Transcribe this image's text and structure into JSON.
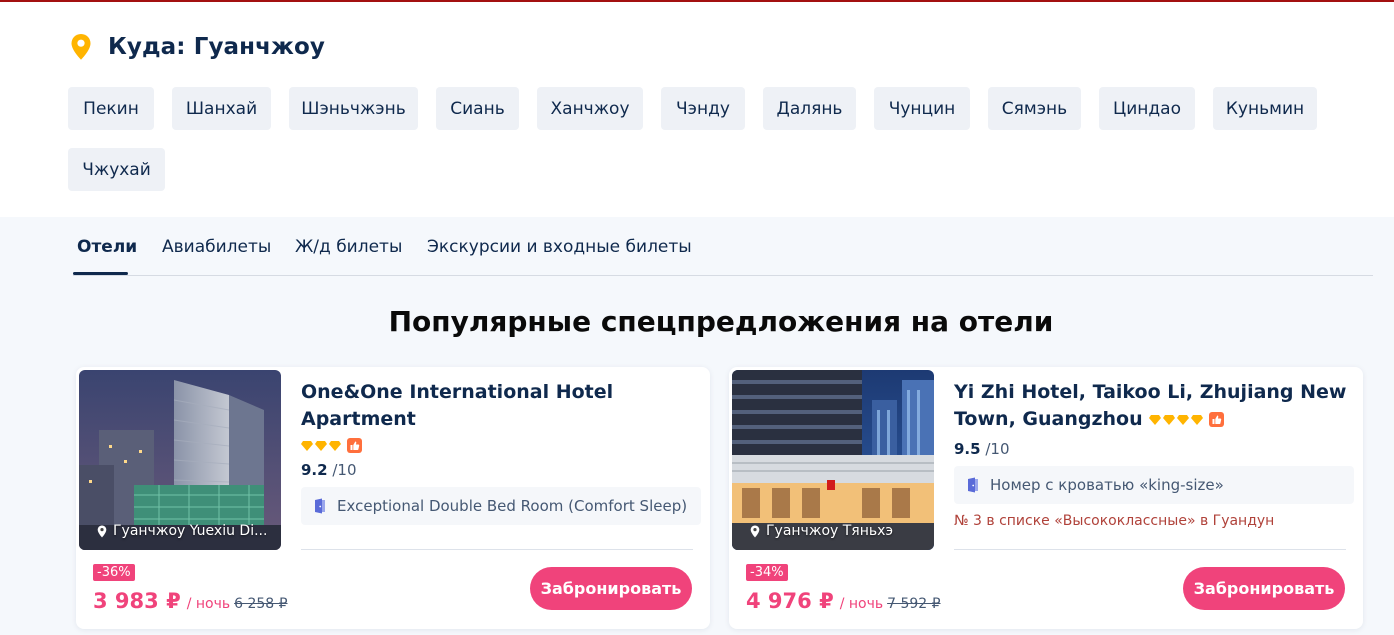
{
  "destination": {
    "label": "Куда: Гуанчжоу",
    "cities": [
      "Пекин",
      "Шанхай",
      "Шэньчжэнь",
      "Сиань",
      "Ханчжоу",
      "Чэнду",
      "Далянь",
      "Чунцин",
      "Сямэнь",
      "Циндао",
      "Куньмин",
      "Чжухай"
    ]
  },
  "tabs": [
    {
      "label": "Отели",
      "active": true
    },
    {
      "label": "Авиабилеты",
      "active": false
    },
    {
      "label": "Ж/д билеты",
      "active": false
    },
    {
      "label": "Экскурсии и входные билеты",
      "active": false
    }
  ],
  "section_title": "Популярные спецпредложения на отели",
  "hotels": [
    {
      "name": "One&One International Hotel Apartment",
      "diamonds": 3,
      "rating": "9.2",
      "rating_out": "/10",
      "room": "Exceptional Double Bed Room (Comfort Sleep)",
      "ranking": "",
      "location": "Гуанчжоу Yuexiu Di...",
      "discount": "-36%",
      "price": "3 983 ₽",
      "per_night": "/ ночь",
      "old_price": "6 258 ₽",
      "book_label": "Забронировать"
    },
    {
      "name": "Yi Zhi Hotel, Taikoo Li, Zhujiang New Town, Guangzhou",
      "diamonds": 4,
      "rating": "9.5",
      "rating_out": "/10",
      "room": "Номер с кроватью «king-size»",
      "ranking": "№ 3 в списке «Высококлассные» в Гуандун",
      "location": "Гуанчжоу Тяньхэ",
      "discount": "-34%",
      "price": "4 976 ₽",
      "per_night": "/ ночь",
      "old_price": "7 592 ₽",
      "book_label": "Забронировать"
    }
  ],
  "colors": {
    "accent_pink": "#f0437b",
    "navy": "#0f294d",
    "pin_yellow": "#ffb400",
    "top_line": "#a31010"
  }
}
